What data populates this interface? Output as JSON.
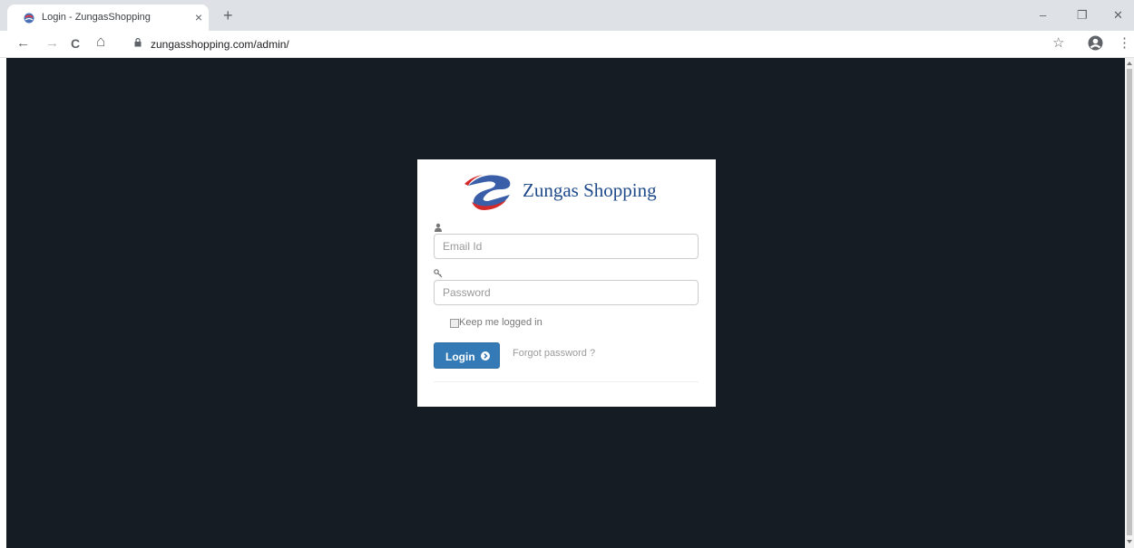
{
  "browser": {
    "tab_title": "Login - ZungasShopping",
    "tab_close": "×",
    "new_tab": "+",
    "url": "zungasshopping.com/admin/",
    "window_controls": {
      "minimize": "–",
      "restore": "❐",
      "close": "✕"
    },
    "nav": {
      "back": "←",
      "forward": "→",
      "reload": "C",
      "home": "⌂",
      "bookmark": "☆",
      "menu": "⋮"
    }
  },
  "login": {
    "brand_name": "Zungas Shopping",
    "email_placeholder": "Email Id",
    "password_placeholder": "Password",
    "remember_label": "Keep me logged in",
    "login_button": "Login",
    "forgot_password": "Forgot password ?"
  },
  "icons": {
    "user_field": "user-icon",
    "password_field": "key-icon",
    "login_arrow": "arrow-circle-right-icon",
    "secure": "lock-icon"
  },
  "colors": {
    "page_background": "#161c24",
    "card_background": "#ffffff",
    "primary_button": "#337ab7",
    "brand_text": "#1f4a8a",
    "logo_red": "#d42a2a"
  }
}
